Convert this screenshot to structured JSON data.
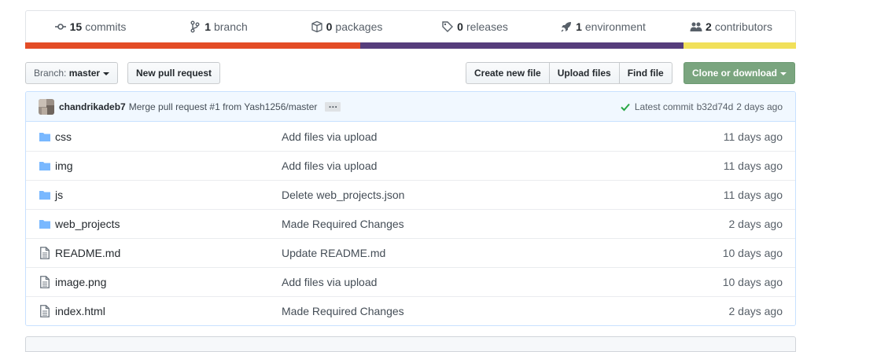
{
  "summary": {
    "stats": [
      {
        "icon": "history-icon",
        "num": "15",
        "label": "commits"
      },
      {
        "icon": "branch-icon",
        "num": "1",
        "label": "branch"
      },
      {
        "icon": "package-icon",
        "num": "0",
        "label": "packages"
      },
      {
        "icon": "tag-icon",
        "num": "0",
        "label": "releases"
      },
      {
        "icon": "rocket-icon",
        "num": "1",
        "label": "environment"
      },
      {
        "icon": "people-icon",
        "num": "2",
        "label": "contributors"
      }
    ],
    "language_colors": [
      "#e34c26",
      "#563d7c",
      "#f1e05a"
    ],
    "language_shares": [
      0.435,
      0.419,
      0.146
    ]
  },
  "toolbar": {
    "branch_prefix": "Branch:",
    "branch_name": "master",
    "new_pull_request": "New pull request",
    "create_new_file": "Create new file",
    "upload_files": "Upload files",
    "find_file": "Find file",
    "clone_or_download": "Clone or download"
  },
  "commit": {
    "author": "chandrikadeb7",
    "message": "Merge pull request #1 from Yash1256/master",
    "ellipsis": "…",
    "latest_label": "Latest commit",
    "sha": "b32d74d",
    "age": "2 days ago"
  },
  "files": [
    {
      "type": "folder",
      "icon": "folder-icon",
      "name": "css",
      "message": "Add files via upload",
      "age": "11 days ago"
    },
    {
      "type": "folder",
      "icon": "folder-icon",
      "name": "img",
      "message": "Add files via upload",
      "age": "11 days ago"
    },
    {
      "type": "folder",
      "icon": "folder-icon",
      "name": "js",
      "message": "Delete web_projects.json",
      "age": "11 days ago"
    },
    {
      "type": "folder",
      "icon": "folder-icon",
      "name": "web_projects",
      "message": "Made Required Changes",
      "age": "2 days ago"
    },
    {
      "type": "file",
      "icon": "file-icon",
      "name": "README.md",
      "message": "Update README.md",
      "age": "10 days ago"
    },
    {
      "type": "file",
      "icon": "file-icon",
      "name": "image.png",
      "message": "Add files via upload",
      "age": "10 days ago"
    },
    {
      "type": "file",
      "icon": "file-icon",
      "name": "index.html",
      "message": "Made Required Changes",
      "age": "2 days ago"
    }
  ],
  "colors": {
    "clone_button": "#7aa57f",
    "folder_icon": "#79b8ff",
    "check": "#28a745"
  }
}
